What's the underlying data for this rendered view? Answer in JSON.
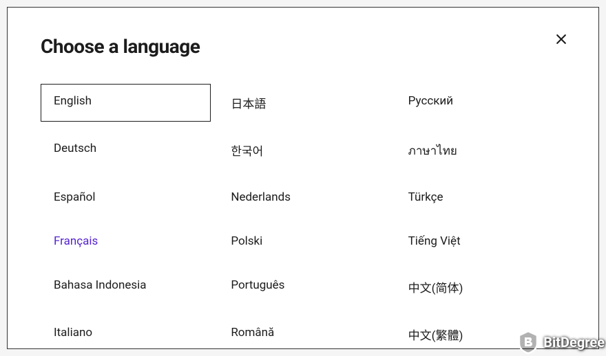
{
  "modal": {
    "title": "Choose a language",
    "close_label": "Close"
  },
  "languages": {
    "col1": [
      {
        "label": "English",
        "selected": true,
        "hover": false
      },
      {
        "label": "Deutsch",
        "selected": false,
        "hover": false
      },
      {
        "label": "Español",
        "selected": false,
        "hover": false
      },
      {
        "label": "Français",
        "selected": false,
        "hover": true
      },
      {
        "label": "Bahasa Indonesia",
        "selected": false,
        "hover": false
      },
      {
        "label": "Italiano",
        "selected": false,
        "hover": false
      }
    ],
    "col2": [
      {
        "label": "日本語",
        "selected": false,
        "hover": false
      },
      {
        "label": "한국어",
        "selected": false,
        "hover": false
      },
      {
        "label": "Nederlands",
        "selected": false,
        "hover": false
      },
      {
        "label": "Polski",
        "selected": false,
        "hover": false
      },
      {
        "label": "Português",
        "selected": false,
        "hover": false
      },
      {
        "label": "Română",
        "selected": false,
        "hover": false
      }
    ],
    "col3": [
      {
        "label": "Русский",
        "selected": false,
        "hover": false
      },
      {
        "label": "ภาษาไทย",
        "selected": false,
        "hover": false
      },
      {
        "label": "Türkçe",
        "selected": false,
        "hover": false
      },
      {
        "label": "Tiếng Việt",
        "selected": false,
        "hover": false
      },
      {
        "label": "中文(简体)",
        "selected": false,
        "hover": false
      },
      {
        "label": "中文(繁體)",
        "selected": false,
        "hover": false
      }
    ]
  },
  "watermark": {
    "text": "BitDegree"
  }
}
